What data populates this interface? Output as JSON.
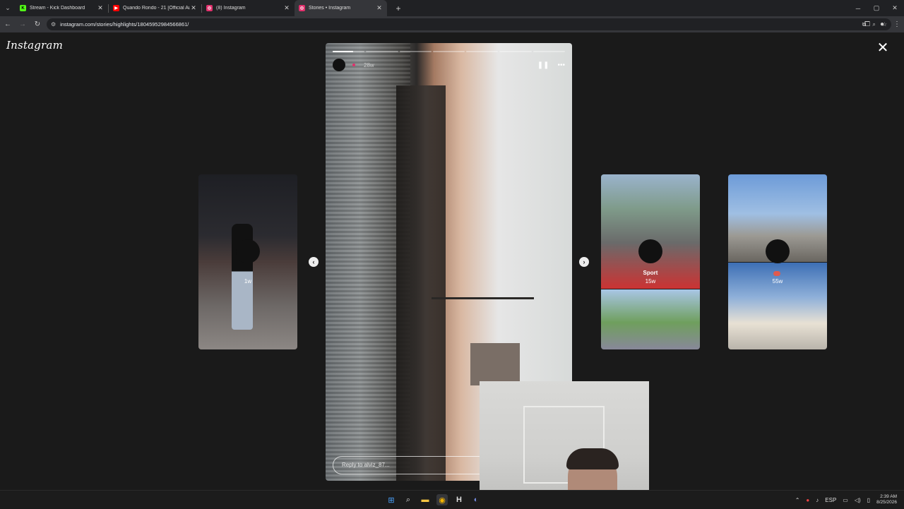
{
  "browser": {
    "tabs": [
      {
        "title": "Stream - Kick Dashboard",
        "favicon": "kick-icon",
        "color": "#53fc18",
        "letter": "K",
        "active": false
      },
      {
        "title": "Quando Rondo - 21 [Official Au",
        "favicon": "youtube-icon",
        "color": "#ff0000",
        "letter": "▶",
        "active": false
      },
      {
        "title": "(8) Instagram",
        "favicon": "instagram-icon",
        "color": "#e1306c",
        "letter": "◎",
        "active": false
      },
      {
        "title": "Stories • Instagram",
        "favicon": "instagram-icon",
        "color": "#e1306c",
        "letter": "◎",
        "active": true
      }
    ],
    "url": "instagram.com/stories/highlights/18045952984566861/"
  },
  "instagram": {
    "logo": "Instagram",
    "story": {
      "age": "28w",
      "reply_placeholder": "Reply to alviz_87...",
      "progress_segments": 7,
      "progress_current": 0.65
    },
    "prev_card": {
      "age": "1w"
    },
    "next_cards": [
      {
        "name": "Sport",
        "age": "15w"
      },
      {
        "name": "",
        "age": "55w"
      }
    ],
    "accent_color": "#e1306c"
  },
  "taskbar": {
    "language": "ESP",
    "time": "2:39 AM",
    "date": "8/25/2026"
  }
}
